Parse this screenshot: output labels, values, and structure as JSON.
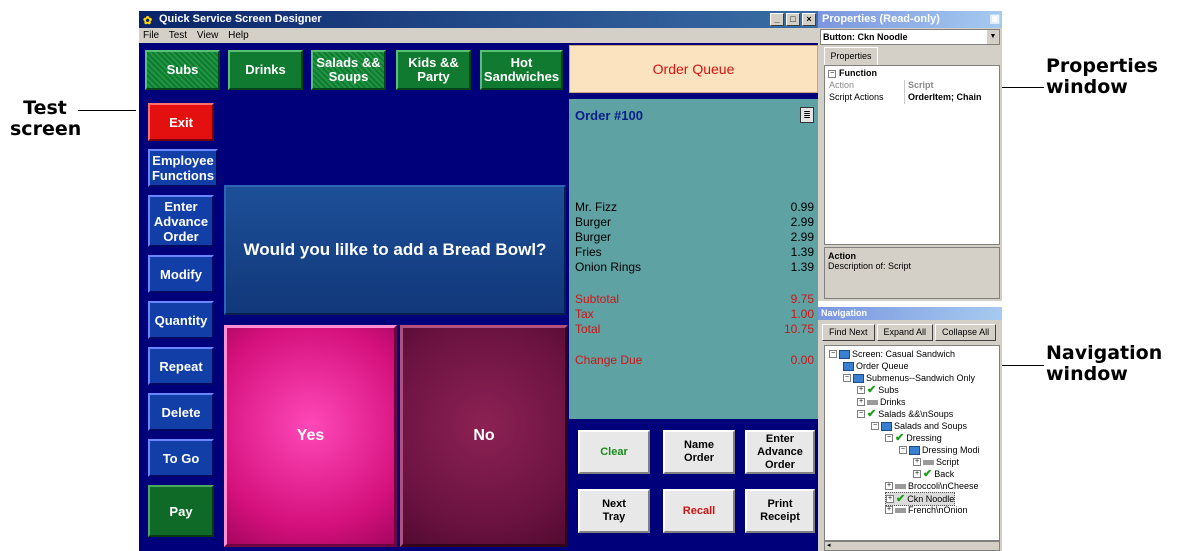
{
  "callouts": {
    "test_screen": "Test\nscreen",
    "properties": "Properties\nwindow",
    "navigation": "Navigation\nwindow"
  },
  "app": {
    "title": "Quick Service Screen Designer",
    "controls": [
      "_",
      "□",
      "×"
    ],
    "menu": [
      "File",
      "Test",
      "View",
      "Help"
    ]
  },
  "nav_buttons": [
    "Subs",
    "Drinks",
    "Salads &&\nSoups",
    "Kids &&\nParty",
    "Hot\nSandwiches"
  ],
  "order_queue": "Order Queue",
  "side_buttons": [
    "Exit",
    "Employee\nFunctions",
    "Enter\nAdvance\nOrder",
    "Modify",
    "Quantity",
    "Repeat",
    "Delete",
    "To Go",
    "Pay"
  ],
  "prompt": "Would you lilke to add a Bread Bowl?",
  "yes": "Yes",
  "no": "No",
  "order": {
    "header": "Order #100",
    "items": [
      {
        "name": "Mr. Fizz",
        "price": "0.99"
      },
      {
        "name": "Burger",
        "price": "2.99"
      },
      {
        "name": "Burger",
        "price": "2.99"
      },
      {
        "name": "Fries",
        "price": "1.39"
      },
      {
        "name": "Onion Rings",
        "price": "1.39"
      }
    ],
    "subtotal": {
      "label": "Subtotal",
      "value": "9.75"
    },
    "tax": {
      "label": "Tax",
      "value": "1.00"
    },
    "total": {
      "label": "Total",
      "value": "10.75"
    },
    "change": {
      "label": "Change Due",
      "value": "0.00"
    }
  },
  "actions": [
    "Clear",
    "Name\nOrder",
    "Enter\nAdvance\nOrder",
    "Next\nTray",
    "Recall",
    "Print\nReceipt"
  ],
  "properties": {
    "title": "Properties (Read-only)",
    "selected": "Button: Ckn Noodle",
    "tab": "Properties",
    "section": "Function",
    "rows": [
      {
        "key": "Action",
        "value": "Script"
      },
      {
        "key": "Script Actions",
        "value": "OrderItem; Chain"
      }
    ],
    "desc_title": "Action",
    "desc_text": "Description of: Script"
  },
  "navigation": {
    "title": "Navigation",
    "buttons": [
      "Find Next",
      "Expand All",
      "Collapse All"
    ],
    "tree": [
      "Screen: Casual Sandwich",
      "Order Queue",
      "Submenus--Sandwich Only",
      "Subs",
      "Drinks",
      "Salads &&\\nSoups",
      "Salads and Soups",
      "Dressing",
      "Dressing Modi",
      "Script",
      "Back",
      "Broccoli\\nCheese",
      "Ckn Noodle",
      "French\\nOnion"
    ]
  }
}
